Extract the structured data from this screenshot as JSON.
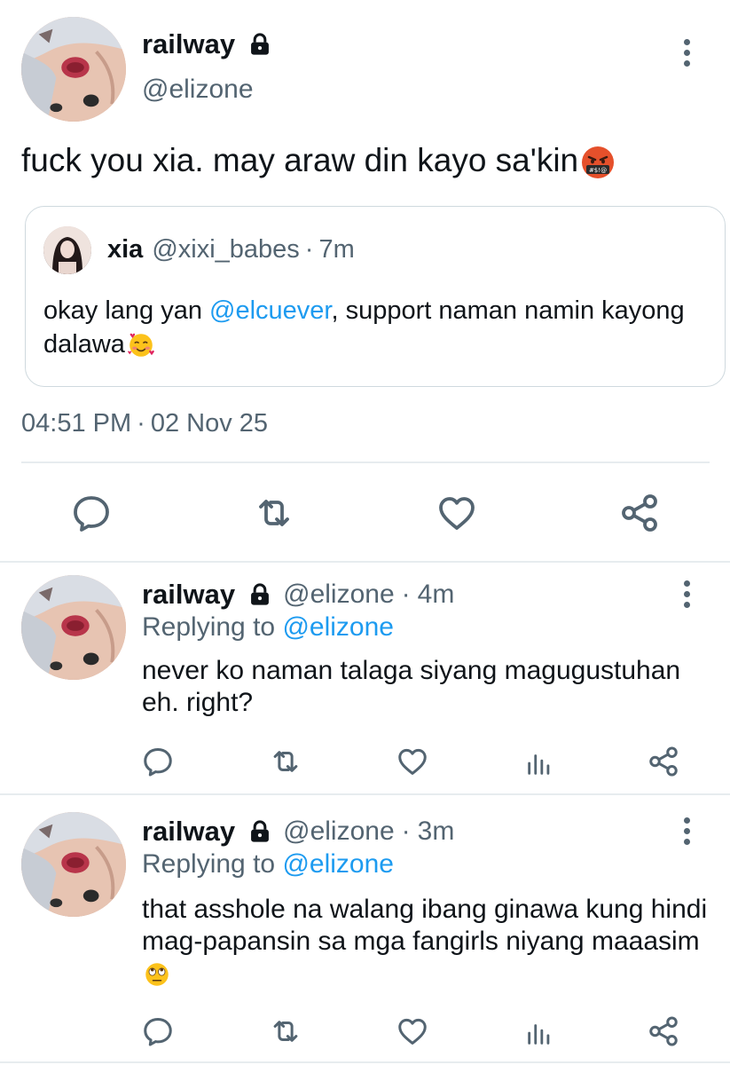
{
  "main_tweet": {
    "name": "railway",
    "handle": "@elizone",
    "text": "fuck you xia. may araw din kayo sa'kin",
    "emoji": "cursing-face-emoji",
    "quote": {
      "name": "xia",
      "handle": "@xixi_babes",
      "dot": "·",
      "time": "7m",
      "text_before": "okay lang yan ",
      "mention": "@elcuever",
      "text_after": ", support naman namin kayong dalawa",
      "emoji": "smiling-face-with-hearts-emoji"
    },
    "time": "04:51 PM",
    "sep": "·",
    "date": "02 Nov 25",
    "actions": [
      "reply-icon",
      "retweet-icon",
      "like-icon",
      "share-icon"
    ]
  },
  "replies": [
    {
      "name": "railway",
      "handle": "@elizone",
      "dot": "·",
      "time": "4m",
      "replying_label": "Replying to ",
      "replying_to": "@elizone",
      "text": "never ko naman talaga siyang magugustuhan eh. right?",
      "actions": [
        "reply-icon",
        "retweet-icon",
        "like-icon",
        "analytics-icon",
        "share-icon"
      ]
    },
    {
      "name": "railway",
      "handle": "@elizone",
      "dot": "·",
      "time": "3m",
      "replying_label": "Replying to ",
      "replying_to": "@elizone",
      "text": "that asshole na walang ibang ginawa kung hindi mag-papansin sa mga fangirls niyang maaasim",
      "emoji": "face-with-rolling-eyes-emoji",
      "actions": [
        "reply-icon",
        "retweet-icon",
        "like-icon",
        "analytics-icon",
        "share-icon"
      ]
    }
  ],
  "colors": {
    "text": "#0f1419",
    "secondary": "#536471",
    "link": "#1d9bf0",
    "border": "#cfd9de",
    "divider": "#e7ecef"
  }
}
